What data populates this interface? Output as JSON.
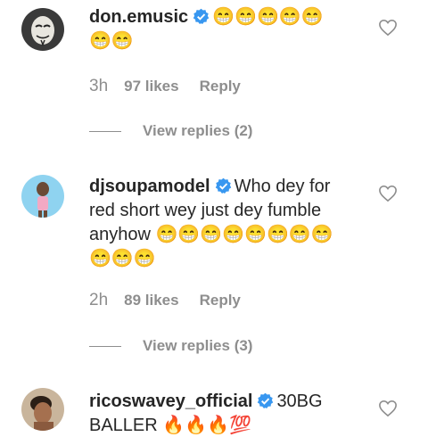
{
  "comments": [
    {
      "username": "don.emusic",
      "text": "😁😁😁😁😁😁😁",
      "time": "3h",
      "likes": "97 likes",
      "reply": "Reply",
      "view_replies": "View replies (2)"
    },
    {
      "username": "djsoupamodel",
      "text": "Who dey for red short wey just dey fumble anyhow 😁😁😁😁😁😁😁😁😁😁😁",
      "time": "2h",
      "likes": "89 likes",
      "reply": "Reply",
      "view_replies": "View replies (3)"
    },
    {
      "username": "ricoswavey_official",
      "text": "30BG BALLER 🔥🔥🔥💯"
    }
  ],
  "icons": {
    "verified": "verified-badge-icon",
    "like": "heart-outline-icon"
  },
  "colors": {
    "verified_blue": "#3897f0",
    "meta_gray": "#8e8e8e",
    "text": "#262626"
  }
}
